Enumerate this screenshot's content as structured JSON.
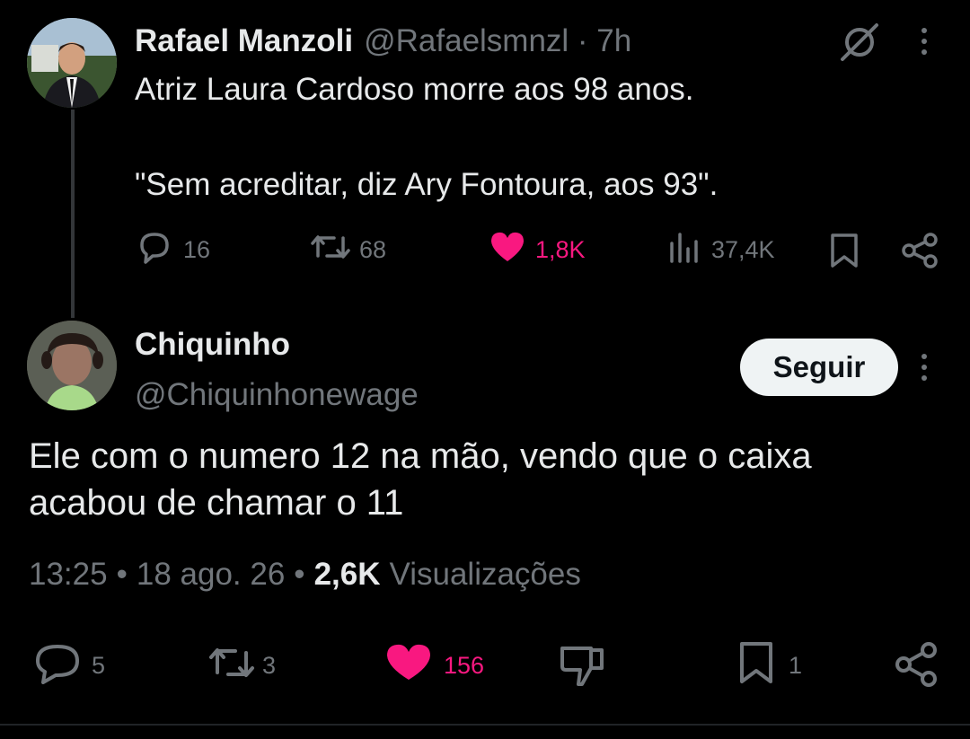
{
  "parent_tweet": {
    "author_name": "Rafael Manzoli",
    "handle_time": "@Rafaelsmnzl · 7h",
    "text_line1": "Atriz Laura Cardoso morre aos 98 anos.",
    "text_line2": "\"Sem acreditar, diz Ary Fontoura, aos 93\".",
    "replies": "16",
    "retweets": "68",
    "likes": "1,8K",
    "views": "37,4K"
  },
  "reply_tweet": {
    "author_name": "Chiquinho",
    "handle": "@Chiquinhonewage",
    "follow_label": "Seguir",
    "text_line1": "Ele com o numero 12 na mão, vendo que o caixa",
    "text_line2": "acabou de chamar o 11",
    "time": "13:25",
    "sep1": "•",
    "date": "18 ago. 26",
    "sep2": "•",
    "views_count": "2,6K",
    "views_label": "Visualizações",
    "replies": "5",
    "retweets": "3",
    "likes": "156",
    "bookmarks": "1"
  },
  "colors": {
    "like": "#f91880",
    "muted": "#71767b",
    "text": "#e7e9ea",
    "background": "#000000"
  },
  "icons": [
    "grok-icon",
    "more-icon",
    "reply-icon",
    "retweet-icon",
    "like-icon",
    "views-icon",
    "bookmark-icon",
    "share-icon",
    "dislike-icon"
  ]
}
